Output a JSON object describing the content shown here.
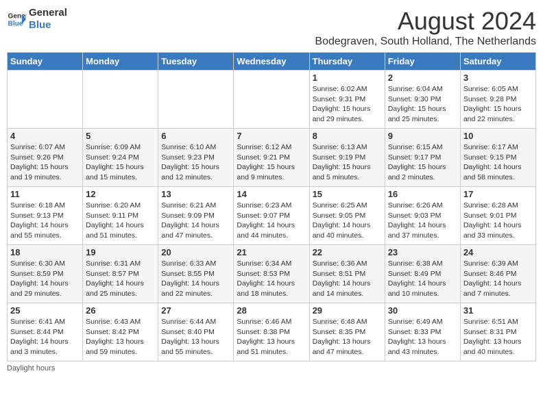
{
  "header": {
    "logo_line1": "General",
    "logo_line2": "Blue",
    "month_title": "August 2024",
    "subtitle": "Bodegraven, South Holland, The Netherlands"
  },
  "weekdays": [
    "Sunday",
    "Monday",
    "Tuesday",
    "Wednesday",
    "Thursday",
    "Friday",
    "Saturday"
  ],
  "footer": "Daylight hours",
  "weeks": [
    [
      {
        "day": "",
        "sunrise": "",
        "sunset": "",
        "daylight": ""
      },
      {
        "day": "",
        "sunrise": "",
        "sunset": "",
        "daylight": ""
      },
      {
        "day": "",
        "sunrise": "",
        "sunset": "",
        "daylight": ""
      },
      {
        "day": "",
        "sunrise": "",
        "sunset": "",
        "daylight": ""
      },
      {
        "day": "1",
        "sunrise": "Sunrise: 6:02 AM",
        "sunset": "Sunset: 9:31 PM",
        "daylight": "Daylight: 15 hours and 29 minutes."
      },
      {
        "day": "2",
        "sunrise": "Sunrise: 6:04 AM",
        "sunset": "Sunset: 9:30 PM",
        "daylight": "Daylight: 15 hours and 25 minutes."
      },
      {
        "day": "3",
        "sunrise": "Sunrise: 6:05 AM",
        "sunset": "Sunset: 9:28 PM",
        "daylight": "Daylight: 15 hours and 22 minutes."
      }
    ],
    [
      {
        "day": "4",
        "sunrise": "Sunrise: 6:07 AM",
        "sunset": "Sunset: 9:26 PM",
        "daylight": "Daylight: 15 hours and 19 minutes."
      },
      {
        "day": "5",
        "sunrise": "Sunrise: 6:09 AM",
        "sunset": "Sunset: 9:24 PM",
        "daylight": "Daylight: 15 hours and 15 minutes."
      },
      {
        "day": "6",
        "sunrise": "Sunrise: 6:10 AM",
        "sunset": "Sunset: 9:23 PM",
        "daylight": "Daylight: 15 hours and 12 minutes."
      },
      {
        "day": "7",
        "sunrise": "Sunrise: 6:12 AM",
        "sunset": "Sunset: 9:21 PM",
        "daylight": "Daylight: 15 hours and 9 minutes."
      },
      {
        "day": "8",
        "sunrise": "Sunrise: 6:13 AM",
        "sunset": "Sunset: 9:19 PM",
        "daylight": "Daylight: 15 hours and 5 minutes."
      },
      {
        "day": "9",
        "sunrise": "Sunrise: 6:15 AM",
        "sunset": "Sunset: 9:17 PM",
        "daylight": "Daylight: 15 hours and 2 minutes."
      },
      {
        "day": "10",
        "sunrise": "Sunrise: 6:17 AM",
        "sunset": "Sunset: 9:15 PM",
        "daylight": "Daylight: 14 hours and 58 minutes."
      }
    ],
    [
      {
        "day": "11",
        "sunrise": "Sunrise: 6:18 AM",
        "sunset": "Sunset: 9:13 PM",
        "daylight": "Daylight: 14 hours and 55 minutes."
      },
      {
        "day": "12",
        "sunrise": "Sunrise: 6:20 AM",
        "sunset": "Sunset: 9:11 PM",
        "daylight": "Daylight: 14 hours and 51 minutes."
      },
      {
        "day": "13",
        "sunrise": "Sunrise: 6:21 AM",
        "sunset": "Sunset: 9:09 PM",
        "daylight": "Daylight: 14 hours and 47 minutes."
      },
      {
        "day": "14",
        "sunrise": "Sunrise: 6:23 AM",
        "sunset": "Sunset: 9:07 PM",
        "daylight": "Daylight: 14 hours and 44 minutes."
      },
      {
        "day": "15",
        "sunrise": "Sunrise: 6:25 AM",
        "sunset": "Sunset: 9:05 PM",
        "daylight": "Daylight: 14 hours and 40 minutes."
      },
      {
        "day": "16",
        "sunrise": "Sunrise: 6:26 AM",
        "sunset": "Sunset: 9:03 PM",
        "daylight": "Daylight: 14 hours and 37 minutes."
      },
      {
        "day": "17",
        "sunrise": "Sunrise: 6:28 AM",
        "sunset": "Sunset: 9:01 PM",
        "daylight": "Daylight: 14 hours and 33 minutes."
      }
    ],
    [
      {
        "day": "18",
        "sunrise": "Sunrise: 6:30 AM",
        "sunset": "Sunset: 8:59 PM",
        "daylight": "Daylight: 14 hours and 29 minutes."
      },
      {
        "day": "19",
        "sunrise": "Sunrise: 6:31 AM",
        "sunset": "Sunset: 8:57 PM",
        "daylight": "Daylight: 14 hours and 25 minutes."
      },
      {
        "day": "20",
        "sunrise": "Sunrise: 6:33 AM",
        "sunset": "Sunset: 8:55 PM",
        "daylight": "Daylight: 14 hours and 22 minutes."
      },
      {
        "day": "21",
        "sunrise": "Sunrise: 6:34 AM",
        "sunset": "Sunset: 8:53 PM",
        "daylight": "Daylight: 14 hours and 18 minutes."
      },
      {
        "day": "22",
        "sunrise": "Sunrise: 6:36 AM",
        "sunset": "Sunset: 8:51 PM",
        "daylight": "Daylight: 14 hours and 14 minutes."
      },
      {
        "day": "23",
        "sunrise": "Sunrise: 6:38 AM",
        "sunset": "Sunset: 8:49 PM",
        "daylight": "Daylight: 14 hours and 10 minutes."
      },
      {
        "day": "24",
        "sunrise": "Sunrise: 6:39 AM",
        "sunset": "Sunset: 8:46 PM",
        "daylight": "Daylight: 14 hours and 7 minutes."
      }
    ],
    [
      {
        "day": "25",
        "sunrise": "Sunrise: 6:41 AM",
        "sunset": "Sunset: 8:44 PM",
        "daylight": "Daylight: 14 hours and 3 minutes."
      },
      {
        "day": "26",
        "sunrise": "Sunrise: 6:43 AM",
        "sunset": "Sunset: 8:42 PM",
        "daylight": "Daylight: 13 hours and 59 minutes."
      },
      {
        "day": "27",
        "sunrise": "Sunrise: 6:44 AM",
        "sunset": "Sunset: 8:40 PM",
        "daylight": "Daylight: 13 hours and 55 minutes."
      },
      {
        "day": "28",
        "sunrise": "Sunrise: 6:46 AM",
        "sunset": "Sunset: 8:38 PM",
        "daylight": "Daylight: 13 hours and 51 minutes."
      },
      {
        "day": "29",
        "sunrise": "Sunrise: 6:48 AM",
        "sunset": "Sunset: 8:35 PM",
        "daylight": "Daylight: 13 hours and 47 minutes."
      },
      {
        "day": "30",
        "sunrise": "Sunrise: 6:49 AM",
        "sunset": "Sunset: 8:33 PM",
        "daylight": "Daylight: 13 hours and 43 minutes."
      },
      {
        "day": "31",
        "sunrise": "Sunrise: 6:51 AM",
        "sunset": "Sunset: 8:31 PM",
        "daylight": "Daylight: 13 hours and 40 minutes."
      }
    ]
  ]
}
